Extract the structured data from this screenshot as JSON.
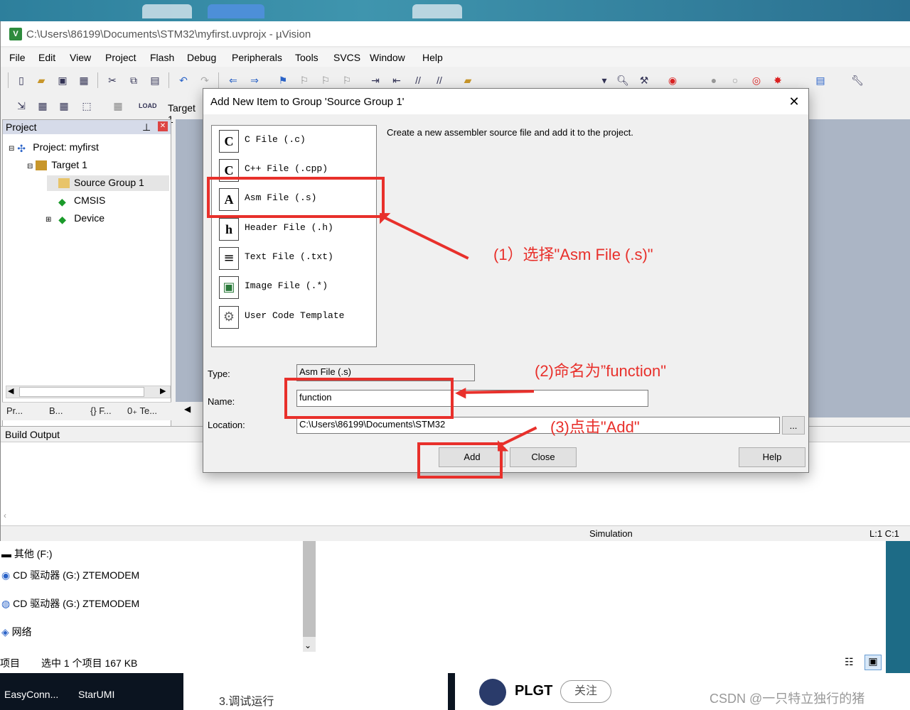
{
  "window": {
    "title": "C:\\Users\\86199\\Documents\\STM32\\myfirst.uvprojx - µVision",
    "icon_letter": "V"
  },
  "menu": [
    "File",
    "Edit",
    "View",
    "Project",
    "Flash",
    "Debug",
    "Peripherals",
    "Tools",
    "SVCS",
    "Window",
    "Help"
  ],
  "toolbar2": {
    "target_label": "Target 1"
  },
  "project_panel": {
    "header": "Project",
    "tree": [
      "Project: myfirst",
      "Target 1",
      "Source Group 1",
      "CMSIS",
      "Device"
    ],
    "tabs": [
      "Pr...",
      "B...",
      "{} F...",
      "0₊ Te..."
    ]
  },
  "build_output": {
    "header": "Build Output"
  },
  "statusbar": {
    "mode": "Simulation",
    "position": "L:1 C:1"
  },
  "dialog": {
    "title": "Add New Item to Group 'Source Group 1'",
    "close_glyph": "✕",
    "file_types": [
      {
        "icon": "C",
        "label": "C File (.c)"
      },
      {
        "icon": "C",
        "label": "C++ File (.cpp)"
      },
      {
        "icon": "A",
        "label": "Asm File (.s)"
      },
      {
        "icon": "h",
        "label": "Header File (.h)"
      },
      {
        "icon": "≡",
        "label": "Text File (.txt)"
      },
      {
        "icon": "▣",
        "label": "Image File (.*)"
      },
      {
        "icon": "⚙",
        "label": "User Code Template"
      }
    ],
    "description": "Create a new assembler source file and add it to the project.",
    "type_label": "Type:",
    "type_value": "Asm File (.s)",
    "name_label": "Name:",
    "name_value": "function",
    "location_label": "Location:",
    "location_value": "C:\\Users\\86199\\Documents\\STM32",
    "browse_label": "...",
    "add_label": "Add",
    "close_label": "Close",
    "help_label": "Help"
  },
  "annotations": {
    "step1": "(1）选择\"Asm File (.s)\"",
    "step2": "(2)命名为”function\"",
    "step3": "(3)点击\"Add\""
  },
  "explorer": {
    "items": [
      "其他 (F:)",
      "CD 驱动器 (G:) ZTEMODEM",
      "CD 驱动器 (G:) ZTEMODEM",
      "网络"
    ],
    "status_left": "项目",
    "status_right": "选中 1 个项目  167 KB"
  },
  "taskbar": {
    "apps": [
      "EasyConn...",
      "StarUMI"
    ],
    "article_line": "3.调试运行",
    "author": "PLGT",
    "follow": "关注",
    "watermark": "CSDN @一只特立独行的猪"
  },
  "colors": {
    "annotation_red": "#e8302b",
    "tree_header": "#d6dbe9"
  }
}
